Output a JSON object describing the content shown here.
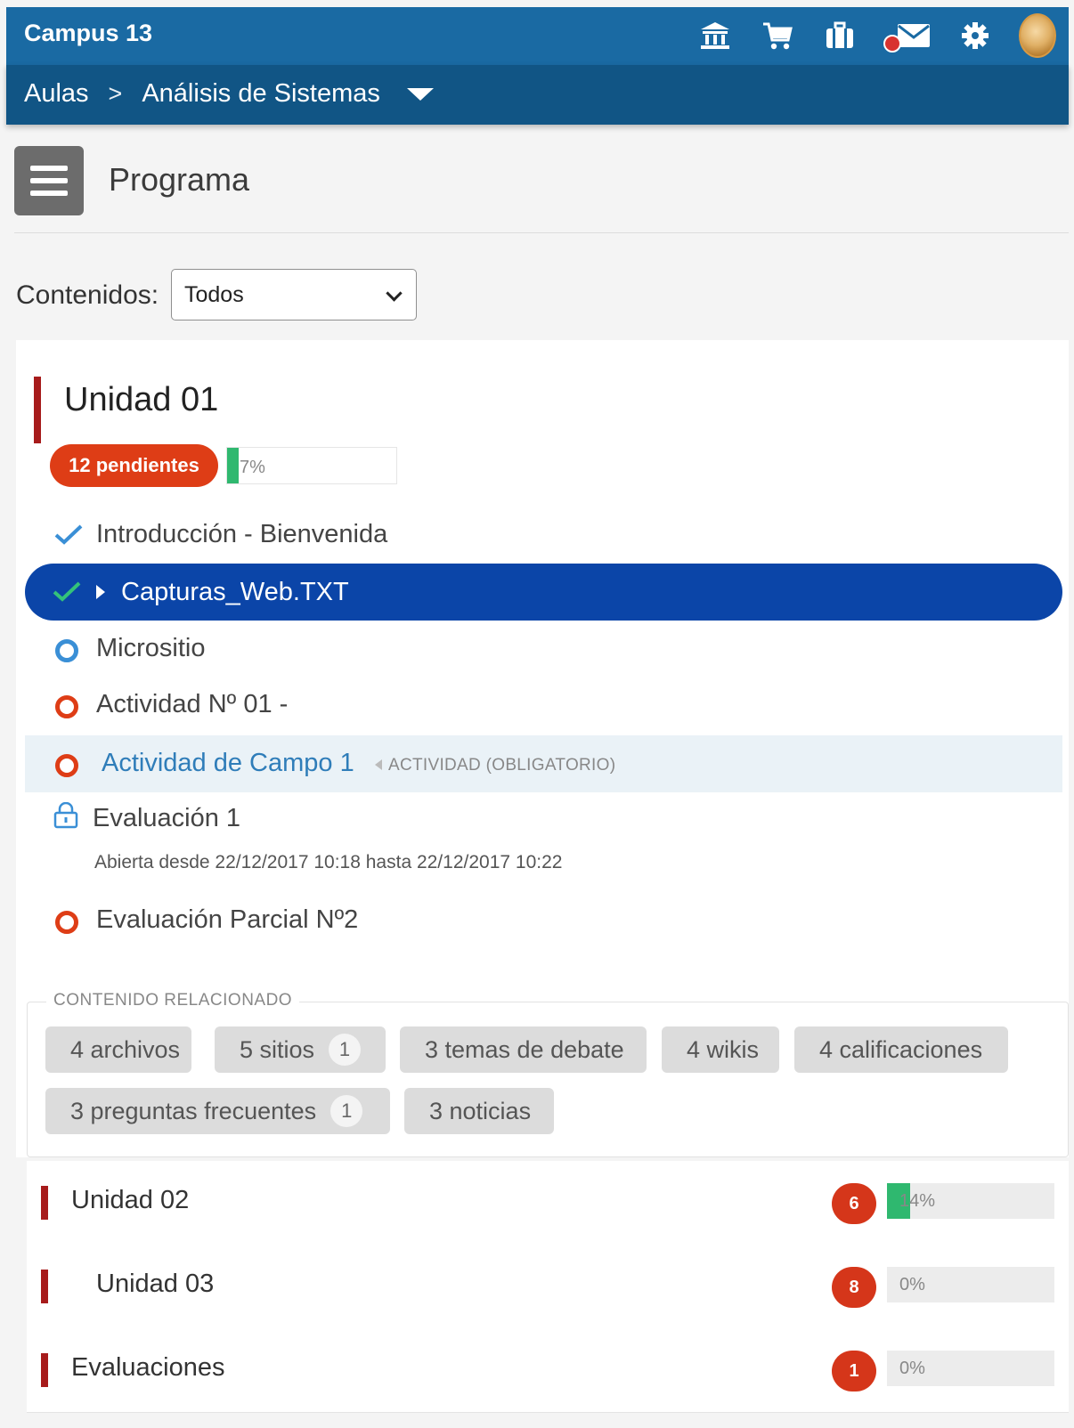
{
  "app": {
    "title": "Campus 13"
  },
  "topbar_icons": [
    "institution-icon",
    "cart-icon",
    "briefcase-icon",
    "mail-icon",
    "gear-icon",
    "avatar"
  ],
  "breadcrumb": {
    "root": "Aulas",
    "separator": ">",
    "current": "Análisis de Sistemas"
  },
  "page": {
    "title": "Programa"
  },
  "filter": {
    "label": "Contenidos:",
    "selected": "Todos"
  },
  "unit1": {
    "title": "Unidad 01",
    "pending_badge": "12 pendientes",
    "progress_label": "7%",
    "progress": 0.07,
    "items": [
      {
        "label": "Introducción - Bienvenida",
        "status": "done"
      },
      {
        "label": "Capturas_Web.TXT",
        "status": "done"
      },
      {
        "label": "Micrositio",
        "status": "in-progress"
      },
      {
        "label": "Actividad Nº 01 -",
        "status": "pending"
      },
      {
        "label": "Actividad de Campo 1",
        "status": "pending",
        "tag": "ACTIVIDAD (OBLIGATORIO)"
      },
      {
        "label": "Evaluación 1",
        "status": "locked",
        "subtext": "Abierta desde 22/12/2017 10:18 hasta 22/12/2017 10:22"
      },
      {
        "label": "Evaluación Parcial Nº2",
        "status": "pending"
      }
    ]
  },
  "related": {
    "legend": "CONTENIDO RELACIONADO",
    "chips": [
      {
        "label": "4 archivos"
      },
      {
        "label": "5 sitios",
        "count": "1"
      },
      {
        "label": "3 temas de debate"
      },
      {
        "label": "4 wikis"
      },
      {
        "label": "4 calificaciones"
      },
      {
        "label": "3 preguntas frecuentes",
        "count": "1"
      },
      {
        "label": "3 noticias"
      }
    ]
  },
  "units": [
    {
      "title": "Unidad 02",
      "pending": "6",
      "progress_label": "14%",
      "progress": 0.14
    },
    {
      "title": "Unidad 03",
      "pending": "8",
      "progress_label": "0%",
      "progress": 0
    },
    {
      "title": "Evaluaciones",
      "pending": "1",
      "progress_label": "0%",
      "progress": 0
    }
  ],
  "colors": {
    "topbar": "#1a6aa3",
    "crumbbar": "#115585",
    "active_row": "#0b45a8",
    "badge": "#de3d16",
    "progress": "#2fb86f",
    "unit_marker": "#a71b1b"
  }
}
